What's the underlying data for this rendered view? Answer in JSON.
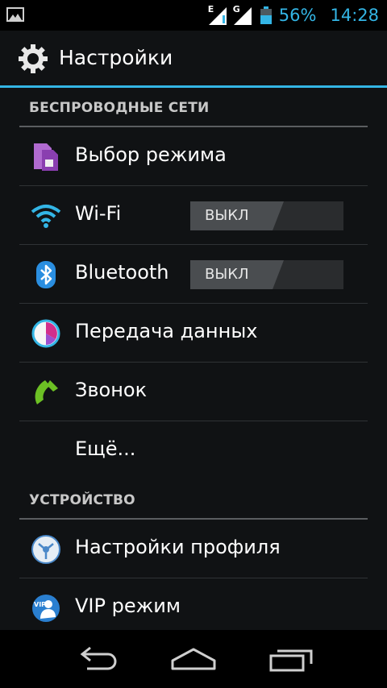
{
  "status_bar": {
    "network_type_1": "E",
    "network_type_2": "G",
    "battery_percent": "56%",
    "time": "14:28",
    "accent_color": "#33b5e5"
  },
  "action_bar": {
    "title": "Настройки",
    "icon": "gear-icon"
  },
  "sections": [
    {
      "header": "БЕСПРОВОДНЫЕ СЕТИ",
      "items": [
        {
          "label": "Выбор режима",
          "icon": "sim-card-icon"
        },
        {
          "label": "Wi-Fi",
          "icon": "wifi-icon",
          "toggle": "ВЫКЛ"
        },
        {
          "label": "Bluetooth",
          "icon": "bluetooth-icon",
          "toggle": "ВЫКЛ"
        },
        {
          "label": "Передача данных",
          "icon": "data-usage-icon"
        },
        {
          "label": "Звонок",
          "icon": "phone-icon"
        },
        {
          "label": "Ещё..."
        }
      ]
    },
    {
      "header": "УСТРОЙСТВО",
      "items": [
        {
          "label": "Настройки профиля",
          "icon": "profile-icon"
        },
        {
          "label": "VIP режим",
          "icon": "vip-icon"
        }
      ]
    }
  ],
  "nav_bar": {
    "back": "back-icon",
    "home": "home-icon",
    "recents": "recents-icon"
  }
}
